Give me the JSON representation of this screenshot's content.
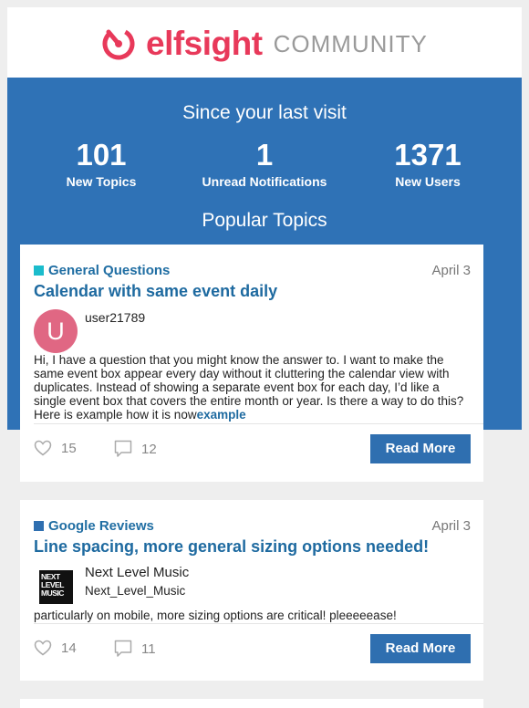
{
  "header": {
    "brand": "elfsight",
    "community": "COMMUNITY"
  },
  "hero": {
    "since_label": "Since your last visit",
    "stats": [
      {
        "value": "101",
        "label": "New Topics"
      },
      {
        "value": "1",
        "label": "Unread Notifications"
      },
      {
        "value": "1371",
        "label": "New Users"
      }
    ],
    "popular_label": "Popular Topics"
  },
  "topics": [
    {
      "category": "General Questions",
      "category_color": "#1bbccc",
      "date": "April 3",
      "title": "Calendar with same event daily",
      "avatar_letter": "U",
      "username": "user21789",
      "body": "Hi, I have a question that you might know the answer to. I want to make the same event box appear every day without it cluttering the calendar view with duplicates. Instead of showing a separate event box for each day, I’d like a single event box that covers the entire month or year. Is there a way to do this? Here is example how it is now",
      "link_text": "example",
      "likes": "15",
      "comments": "12",
      "button": "Read More"
    },
    {
      "category": "Google Reviews",
      "category_color": "#2f6fb0",
      "date": "April 3",
      "title": "Line spacing, more general sizing options needed!",
      "avatar_text": "NEXT LEVEL MUSIC",
      "display_name": "Next Level Music",
      "username": "Next_Level_Music",
      "body": "particularly on mobile, more sizing options are critical! pleeeeease!",
      "likes": "14",
      "comments": "11",
      "button": "Read More"
    }
  ]
}
